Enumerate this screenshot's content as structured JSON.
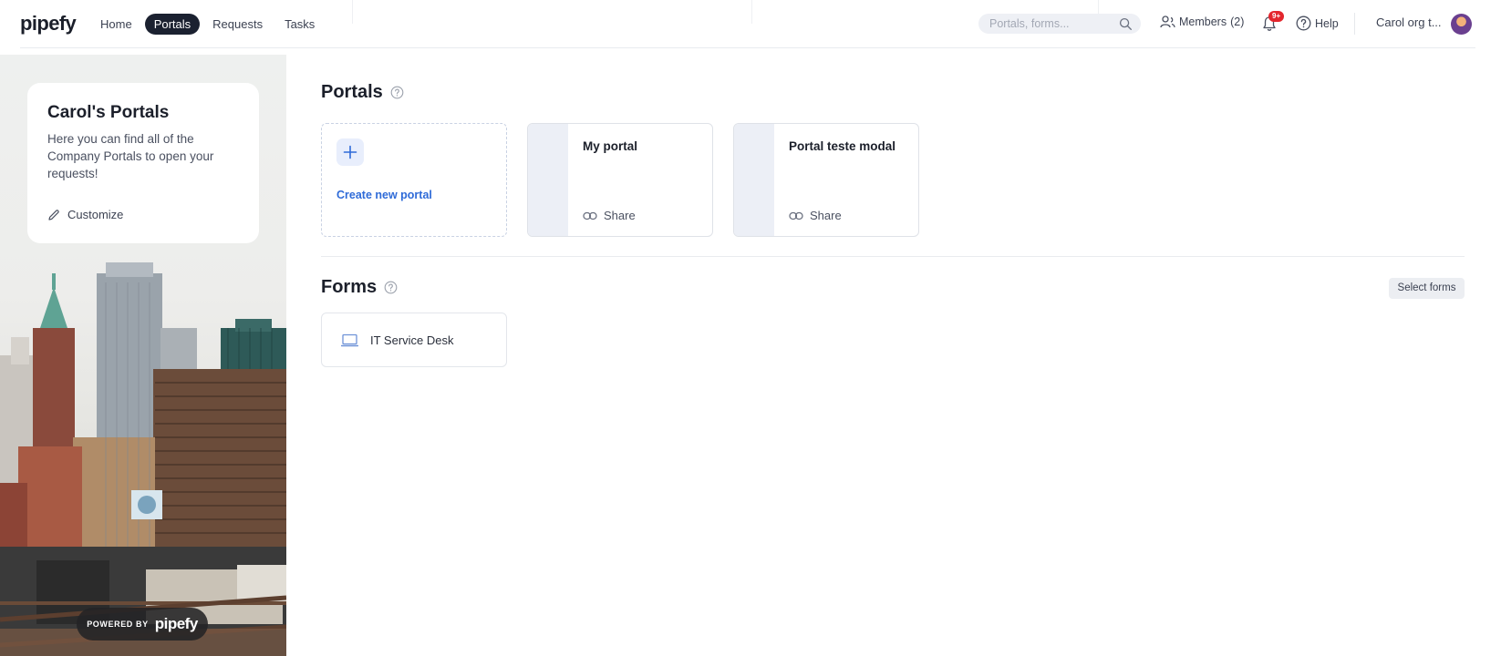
{
  "brand": {
    "logo": "pipefy"
  },
  "nav": {
    "items": [
      "Home",
      "Portals",
      "Requests",
      "Tasks"
    ],
    "active": "Portals"
  },
  "search": {
    "placeholder": "Portals, forms..."
  },
  "header": {
    "members_label": "Members",
    "members_count": "(2)",
    "notifications_badge": "9+",
    "help_label": "Help",
    "org_name": "Carol org t..."
  },
  "sidebar": {
    "title": "Carol's Portals",
    "description": "Here you can find all of the Company Portals to open your requests!",
    "customize_label": "Customize",
    "powered_by": "POWERED BY",
    "powered_logo": "pipefy"
  },
  "portals": {
    "title": "Portals",
    "create_label": "Create new portal",
    "items": [
      {
        "name": "My portal",
        "share_label": "Share"
      },
      {
        "name": "Portal teste modal",
        "share_label": "Share"
      }
    ]
  },
  "forms": {
    "title": "Forms",
    "select_label": "Select forms",
    "items": [
      {
        "name": "IT Service Desk"
      }
    ]
  },
  "colors": {
    "accent_blue": "#2f6bd8",
    "nav_active_bg": "#1b2130",
    "badge_red": "#e3262d"
  }
}
